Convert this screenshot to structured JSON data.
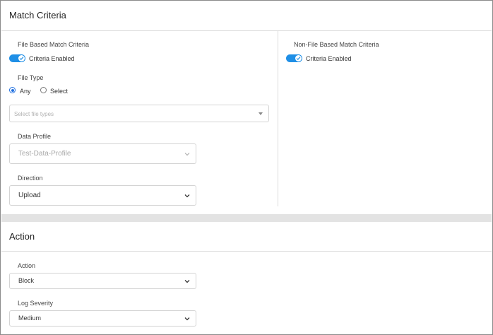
{
  "match_criteria": {
    "title": "Match Criteria",
    "file_based": {
      "heading": "File Based Match Criteria",
      "toggle_label": "Criteria Enabled",
      "file_type_label": "File Type",
      "options": [
        "Any",
        "Select"
      ],
      "selected_option": "Any",
      "file_types_placeholder": "Select file types",
      "data_profile_label": "Data Profile",
      "data_profile_value": "Test-Data-Profile",
      "direction_label": "Direction",
      "direction_value": "Upload"
    },
    "non_file_based": {
      "heading": "Non-File Based Match Criteria",
      "toggle_label": "Criteria Enabled"
    }
  },
  "action": {
    "title": "Action",
    "action_label": "Action",
    "action_value": "Block",
    "log_severity_label": "Log Severity",
    "log_severity_value": "Medium"
  },
  "colors": {
    "accent": "#1f8fe6",
    "border": "#dcdcdc",
    "band": "#e3e3e3"
  }
}
